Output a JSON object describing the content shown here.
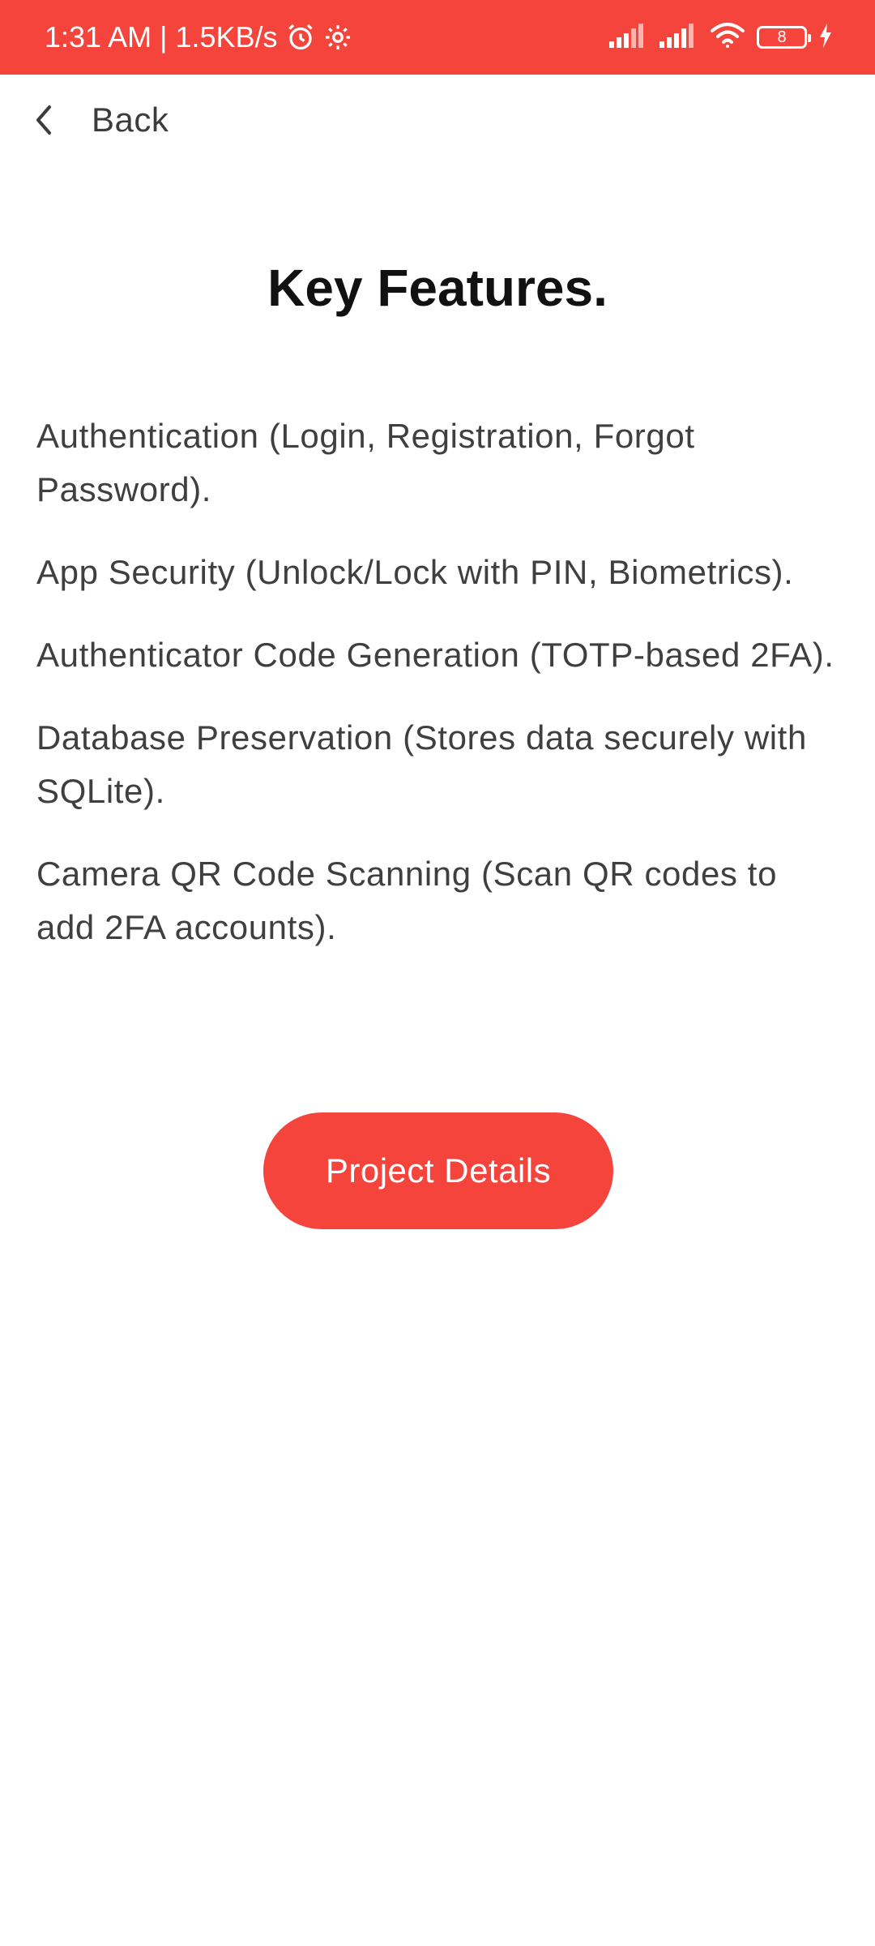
{
  "status_bar": {
    "time_speed": "1:31 AM | 1.5KB/s",
    "icons": [
      "alarm-icon",
      "settings-icon",
      "signal-icon",
      "signal-icon",
      "wifi-icon",
      "battery-icon",
      "charging-icon"
    ],
    "battery_level": "8",
    "background_color": "#f5443b"
  },
  "nav": {
    "back_label": "Back"
  },
  "page": {
    "title": "Key Features."
  },
  "features": [
    "Authentication (Login, Registration, Forgot Password).",
    "App Security (Unlock/Lock with PIN, Biometrics).",
    "Authenticator Code Generation (TOTP-based 2FA).",
    "Database Preservation (Stores data securely with SQLite).",
    "Camera QR Code Scanning (Scan QR codes to add 2FA accounts)."
  ],
  "cta": {
    "label": "Project Details",
    "color": "#f5443b"
  }
}
